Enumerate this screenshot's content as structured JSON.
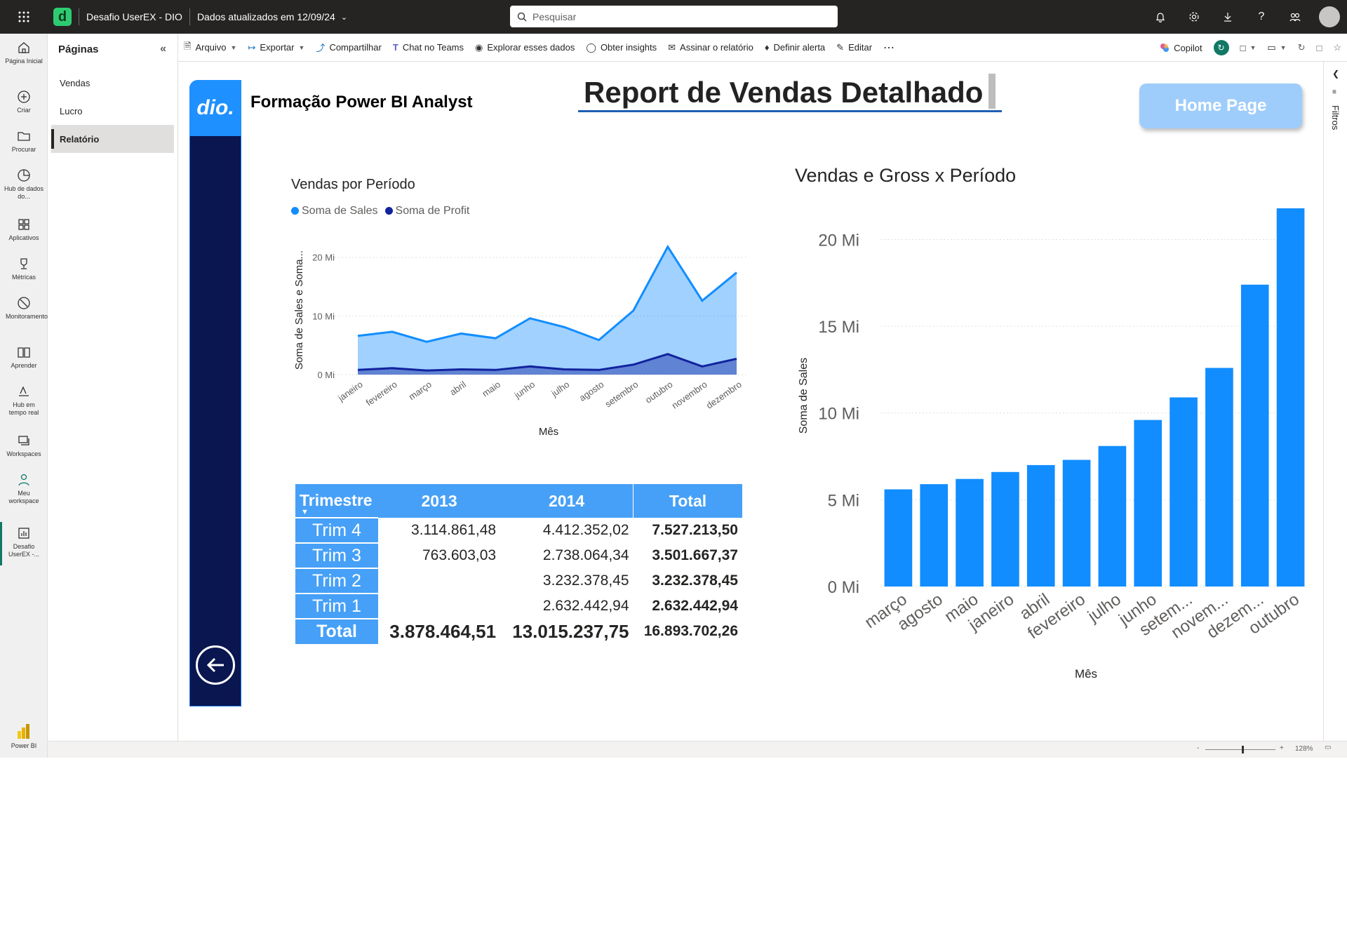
{
  "topbar": {
    "app_title": "Desafio UserEX - DIO",
    "updated": "Dados atualizados em 12/09/24",
    "search_placeholder": "Pesquisar"
  },
  "rail": [
    {
      "label": "Página Inicial",
      "icon": "home-icon"
    },
    {
      "label": "Criar",
      "icon": "create-icon"
    },
    {
      "label": "Procurar",
      "icon": "folder-icon"
    },
    {
      "label": "Hub de dados do...",
      "icon": "data-hub-icon"
    },
    {
      "label": "Aplicativos",
      "icon": "apps-icon"
    },
    {
      "label": "Métricas",
      "icon": "trophy-icon"
    },
    {
      "label": "Monitoramento",
      "icon": "monitor-icon"
    },
    {
      "label": "Aprender",
      "icon": "book-icon"
    },
    {
      "label": "Hub em tempo real",
      "icon": "realtime-icon"
    },
    {
      "label": "Workspaces",
      "icon": "workspaces-icon"
    },
    {
      "label": "Meu workspace",
      "icon": "person-icon"
    },
    {
      "label": "Desafio UserEX -...",
      "icon": "report-icon"
    },
    {
      "label": "Power BI",
      "icon": "powerbi-icon"
    }
  ],
  "pages": {
    "title": "Páginas",
    "items": [
      "Vendas",
      "Lucro",
      "Relatório"
    ]
  },
  "commands": {
    "arquivo": "Arquivo",
    "exportar": "Exportar",
    "compartilhar": "Compartilhar",
    "teams": "Chat no Teams",
    "explorar": "Explorar esses dados",
    "insights": "Obter insights",
    "assinar": "Assinar o relatório",
    "alerta": "Definir alerta",
    "editar": "Editar",
    "copilot": "Copilot"
  },
  "filters": {
    "label": "Filtros"
  },
  "status": {
    "zoom": "128%"
  },
  "report": {
    "logo": "dio.",
    "subtitle": "Formação Power BI Analyst",
    "title": "Report de Vendas Detalhado",
    "home_button": "Home Page"
  },
  "chart_data": [
    {
      "type": "area",
      "title": "Vendas por Período",
      "xlabel": "Mês",
      "ylabel": "Soma de Sales e Soma...",
      "ylim": [
        0,
        22
      ],
      "yticks": [
        "0 Mi",
        "10 Mi",
        "20 Mi"
      ],
      "legend_position": "top-left",
      "categories": [
        "janeiro",
        "fevereiro",
        "março",
        "abril",
        "maio",
        "junho",
        "julho",
        "agosto",
        "setembro",
        "outubro",
        "novembro",
        "dezembro"
      ],
      "series": [
        {
          "name": "Soma de  Sales",
          "color": "#118dff",
          "values": [
            6.6,
            7.3,
            5.6,
            7.0,
            6.2,
            9.6,
            8.1,
            5.9,
            10.9,
            21.8,
            12.6,
            17.4
          ]
        },
        {
          "name": "Soma de Profit",
          "color": "#12239e",
          "values": [
            0.8,
            1.1,
            0.7,
            0.9,
            0.8,
            1.4,
            0.9,
            0.8,
            1.7,
            3.5,
            1.4,
            2.7
          ]
        }
      ]
    },
    {
      "type": "bar",
      "title": "Vendas e Gross x Período",
      "xlabel": "Mês",
      "ylabel": "Soma de Sales",
      "ylim": [
        0,
        22
      ],
      "yticks": [
        "0 Mi",
        "5 Mi",
        "10 Mi",
        "15 Mi",
        "20 Mi"
      ],
      "color": "#118dff",
      "categories": [
        "março",
        "agosto",
        "maio",
        "janeiro",
        "abril",
        "fevereiro",
        "julho",
        "junho",
        "setem...",
        "novem...",
        "dezem...",
        "outubro"
      ],
      "values": [
        5.6,
        5.9,
        6.2,
        6.6,
        7.0,
        7.3,
        8.1,
        9.6,
        10.9,
        12.6,
        17.4,
        21.8
      ]
    },
    {
      "type": "table",
      "headers": [
        "Trimestre",
        "2013",
        "2014",
        "Total"
      ],
      "rows": [
        [
          "Trim 4",
          "3.114.861,48",
          "4.412.352,02",
          "7.527.213,50"
        ],
        [
          "Trim 3",
          "763.603,03",
          "2.738.064,34",
          "3.501.667,37"
        ],
        [
          "Trim 2",
          "",
          "3.232.378,45",
          "3.232.378,45"
        ],
        [
          "Trim 1",
          "",
          "2.632.442,94",
          "2.632.442,94"
        ]
      ],
      "total": [
        "Total",
        "3.878.464,51",
        "13.015.237,75",
        "16.893.702,26"
      ]
    }
  ]
}
